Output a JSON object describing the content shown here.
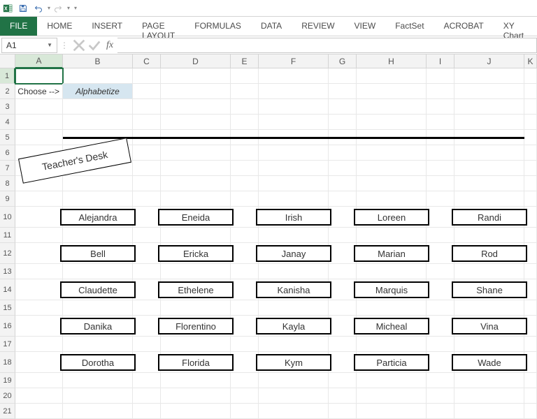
{
  "qat": {
    "save_title": "Save",
    "undo_title": "Undo",
    "redo_title": "Redo"
  },
  "ribbon": {
    "file": "FILE",
    "tabs": [
      "HOME",
      "INSERT",
      "PAGE LAYOUT",
      "FORMULAS",
      "DATA",
      "REVIEW",
      "VIEW",
      "FactSet",
      "ACROBAT",
      "XY Chart Labels"
    ]
  },
  "namebox": {
    "value": "A1"
  },
  "formula_bar": {
    "value": "",
    "cancel_title": "Cancel",
    "enter_title": "Enter",
    "fx_title": "Insert Function",
    "fx_label": "fx"
  },
  "columns": [
    "A",
    "B",
    "C",
    "D",
    "E",
    "F",
    "G",
    "H",
    "I",
    "J",
    "K"
  ],
  "row_count": 21,
  "selected_cell": "A1",
  "cells": {
    "A2": "Choose -->",
    "B2_dropdown": "Alphabetize"
  },
  "shapes": {
    "line": {
      "left_col": "B",
      "right_col": "J_end"
    },
    "teacher_desk_label": "Teacher's Desk",
    "seats": {
      "cols": [
        "B",
        "D",
        "F",
        "H",
        "J"
      ],
      "rows5": 5,
      "grid": [
        [
          "Alejandra",
          "Eneida",
          "Irish",
          "Loreen",
          "Randi"
        ],
        [
          "Bell",
          "Ericka",
          "Janay",
          "Marian",
          "Rod"
        ],
        [
          "Claudette",
          "Ethelene",
          "Kanisha",
          "Marquis",
          "Shane"
        ],
        [
          "Danika",
          "Florentino",
          "Kayla",
          "Micheal",
          "Vina"
        ],
        [
          "Dorotha",
          "Florida",
          "Kym",
          "Particia",
          "Wade"
        ]
      ]
    }
  }
}
